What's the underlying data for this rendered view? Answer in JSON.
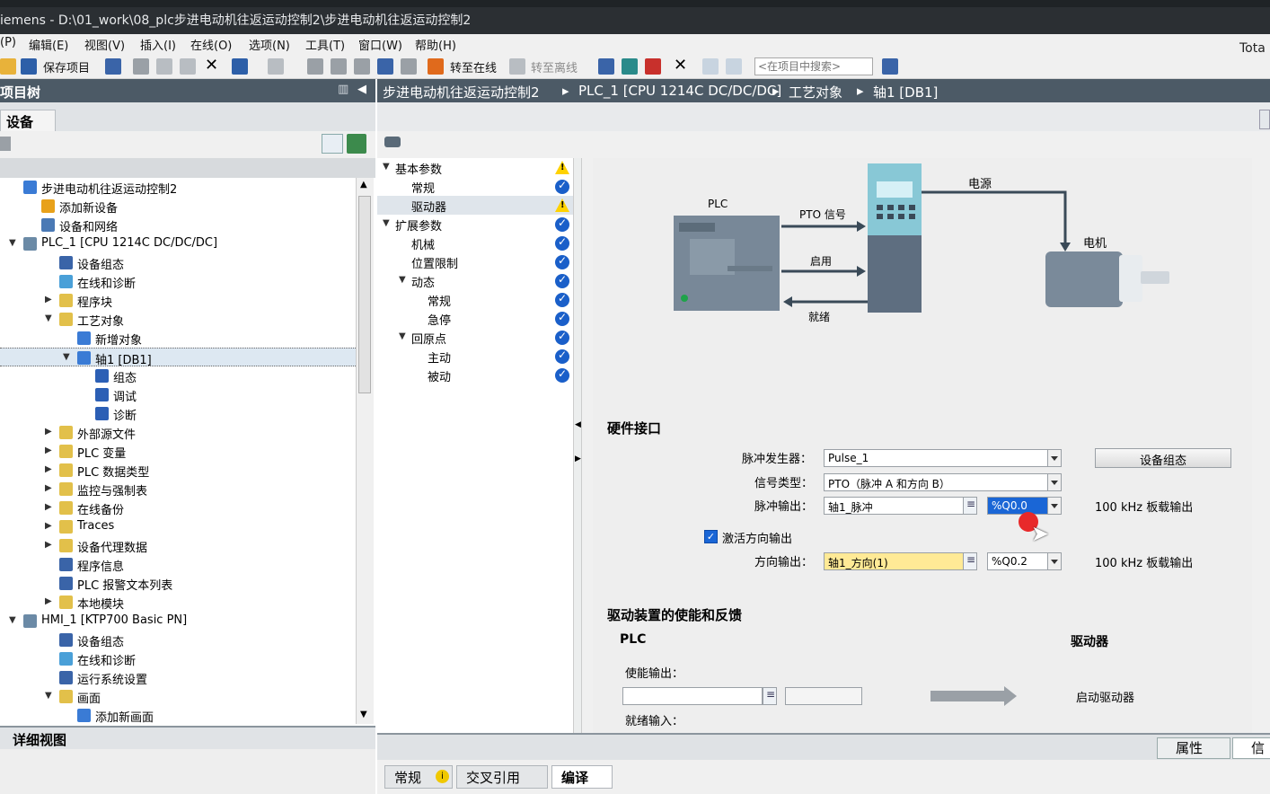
{
  "window": {
    "title": "iemens  -  D:\\01_work\\08_plc步进电动机往返运动控制2\\步进电动机往返运动控制2",
    "tota": "Tota"
  },
  "menu": [
    "(P)",
    "编辑(E)",
    "视图(V)",
    "插入(I)",
    "在线(O)",
    "选项(N)",
    "工具(T)",
    "窗口(W)",
    "帮助(H)"
  ],
  "toolbar": {
    "save_project": "保存项目",
    "go_online": "转至在线",
    "go_offline": "转至离线",
    "search_placeholder": "<在项目中搜索>"
  },
  "left_panel": {
    "header": "项目树",
    "tab": "设备",
    "detail_view": "详细视图",
    "tree": [
      {
        "label": "步进电动机往返运动控制2",
        "indent": 0,
        "arrow": "",
        "icon": "project-icon",
        "color": "#3a7bd5"
      },
      {
        "label": "添加新设备",
        "indent": 1,
        "arrow": "",
        "icon": "add-device-icon",
        "color": "#e8a11a"
      },
      {
        "label": "设备和网络",
        "indent": 1,
        "arrow": "",
        "icon": "network-icon",
        "color": "#4a79b5"
      },
      {
        "label": "PLC_1 [CPU 1214C DC/DC/DC]",
        "indent": 0,
        "arrow": "▼",
        "icon": "plc-icon",
        "color": "#6b8aa6"
      },
      {
        "label": "设备组态",
        "indent": 2,
        "arrow": "",
        "icon": "device-config-icon",
        "color": "#3a64a8"
      },
      {
        "label": "在线和诊断",
        "indent": 2,
        "arrow": "",
        "icon": "diagnostics-icon",
        "color": "#4aa0d8"
      },
      {
        "label": "程序块",
        "indent": 2,
        "arrow": "▶",
        "icon": "folder-icon",
        "color": "#e2c04a"
      },
      {
        "label": "工艺对象",
        "indent": 2,
        "arrow": "▼",
        "icon": "folder-icon",
        "color": "#e2c04a"
      },
      {
        "label": "新增对象",
        "indent": 3,
        "arrow": "",
        "icon": "add-object-icon",
        "color": "#3a7bd5"
      },
      {
        "label": "轴1 [DB1]",
        "indent": 3,
        "arrow": "▼",
        "icon": "axis-icon",
        "color": "#3a7bd5"
      },
      {
        "label": "组态",
        "indent": 4,
        "arrow": "",
        "icon": "config-icon",
        "color": "#2c5fb5"
      },
      {
        "label": "调试",
        "indent": 4,
        "arrow": "",
        "icon": "commissioning-icon",
        "color": "#2c5fb5"
      },
      {
        "label": "诊断",
        "indent": 4,
        "arrow": "",
        "icon": "diagnostic-icon",
        "color": "#2c5fb5"
      },
      {
        "label": "外部源文件",
        "indent": 2,
        "arrow": "▶",
        "icon": "folder-icon",
        "color": "#e2c04a"
      },
      {
        "label": "PLC 变量",
        "indent": 2,
        "arrow": "▶",
        "icon": "folder-icon",
        "color": "#e2c04a"
      },
      {
        "label": "PLC 数据类型",
        "indent": 2,
        "arrow": "▶",
        "icon": "folder-icon",
        "color": "#e2c04a"
      },
      {
        "label": "监控与强制表",
        "indent": 2,
        "arrow": "▶",
        "icon": "folder-icon",
        "color": "#e2c04a"
      },
      {
        "label": "在线备份",
        "indent": 2,
        "arrow": "▶",
        "icon": "folder-icon",
        "color": "#e2c04a"
      },
      {
        "label": "Traces",
        "indent": 2,
        "arrow": "▶",
        "icon": "folder-icon",
        "color": "#e2c04a"
      },
      {
        "label": "设备代理数据",
        "indent": 2,
        "arrow": "▶",
        "icon": "folder-icon",
        "color": "#e2c04a"
      },
      {
        "label": "程序信息",
        "indent": 2,
        "arrow": "",
        "icon": "program-info-icon",
        "color": "#3a64a8"
      },
      {
        "label": "PLC 报警文本列表",
        "indent": 2,
        "arrow": "",
        "icon": "alarm-text-icon",
        "color": "#3a64a8"
      },
      {
        "label": "本地模块",
        "indent": 2,
        "arrow": "▶",
        "icon": "folder-icon",
        "color": "#e2c04a"
      },
      {
        "label": "HMI_1 [KTP700 Basic PN]",
        "indent": 0,
        "arrow": "▼",
        "icon": "hmi-icon",
        "color": "#6b8aa6"
      },
      {
        "label": "设备组态",
        "indent": 2,
        "arrow": "",
        "icon": "device-config-icon",
        "color": "#3a64a8"
      },
      {
        "label": "在线和诊断",
        "indent": 2,
        "arrow": "",
        "icon": "diagnostics-icon",
        "color": "#4aa0d8"
      },
      {
        "label": "运行系统设置",
        "indent": 2,
        "arrow": "",
        "icon": "runtime-settings-icon",
        "color": "#3a64a8"
      },
      {
        "label": "画面",
        "indent": 2,
        "arrow": "▼",
        "icon": "folder-icon",
        "color": "#e2c04a"
      },
      {
        "label": "添加新画面",
        "indent": 3,
        "arrow": "",
        "icon": "add-screen-icon",
        "color": "#3a7bd5"
      }
    ],
    "selected_index": 9
  },
  "breadcrumb": [
    "步进电动机往返运动控制2",
    "PLC_1 [CPU 1214C DC/DC/DC]",
    "工艺对象",
    "轴1 [DB1]"
  ],
  "nav": [
    {
      "label": "基本参数",
      "level": 0,
      "arrow": "▼",
      "status": "warn"
    },
    {
      "label": "常规",
      "level": 1,
      "arrow": "",
      "status": "ok"
    },
    {
      "label": "驱动器",
      "level": 1,
      "arrow": "",
      "status": "warn",
      "selected": true
    },
    {
      "label": "扩展参数",
      "level": 0,
      "arrow": "▼",
      "status": "ok"
    },
    {
      "label": "机械",
      "level": 1,
      "arrow": "",
      "status": "ok"
    },
    {
      "label": "位置限制",
      "level": 1,
      "arrow": "",
      "status": "ok"
    },
    {
      "label": "动态",
      "level": 1,
      "arrow": "▼",
      "status": "ok"
    },
    {
      "label": "常规",
      "level": 2,
      "arrow": "",
      "status": "ok"
    },
    {
      "label": "急停",
      "level": 2,
      "arrow": "",
      "status": "ok"
    },
    {
      "label": "回原点",
      "level": 1,
      "arrow": "▼",
      "status": "ok"
    },
    {
      "label": "主动",
      "level": 2,
      "arrow": "",
      "status": "ok"
    },
    {
      "label": "被动",
      "level": 2,
      "arrow": "",
      "status": "ok"
    }
  ],
  "diagram": {
    "plc": "PLC",
    "pto_signal": "PTO 信号",
    "enable": "启用",
    "ready": "就绪",
    "power": "电源",
    "motor": "电机"
  },
  "hw": {
    "section": "硬件接口",
    "pulse_gen_label": "脉冲发生器：",
    "pulse_gen_value": "Pulse_1",
    "signal_type_label": "信号类型：",
    "signal_type_value": "PTO（脉冲 A 和方向 B）",
    "pulse_out_label": "脉冲输出：",
    "pulse_out_value": "轴1_脉冲",
    "pulse_out_addr": "%Q0.0",
    "pulse_out_note": "100 kHz 板载输出",
    "dir_enable_label": "激活方向输出",
    "dir_out_label": "方向输出：",
    "dir_out_value": "轴1_方向(1)",
    "dir_out_addr": "%Q0.2",
    "dir_out_note": "100 kHz 板载输出",
    "device_config_btn": "设备组态"
  },
  "drive": {
    "section": "驱动装置的使能和反馈",
    "plc": "PLC",
    "drive": "驱动器",
    "enable_out_label": "使能输出：",
    "start_drive": "启动驱动器",
    "ready_in_label": "就绪输入："
  },
  "bottom": {
    "properties": "属性",
    "info": "信",
    "tabs": [
      "常规",
      "交叉引用",
      "编译"
    ]
  }
}
